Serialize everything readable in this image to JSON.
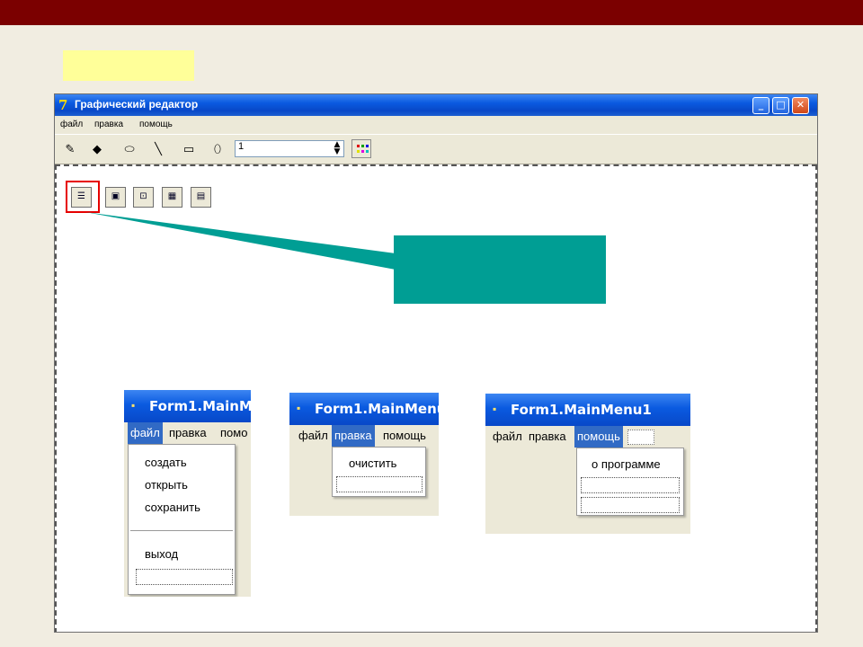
{
  "app": {
    "title": "Графический редактор",
    "menu": [
      "файл",
      "правка",
      "помощь"
    ],
    "width_value": "1",
    "window_buttons": {
      "minimize": "_",
      "maximize": "□",
      "close": "✕"
    }
  },
  "toolbar_icons": [
    "pencil-icon",
    "fill-icon",
    "eraser-icon",
    "line-icon",
    "rectangle-icon",
    "ellipse-icon"
  ],
  "nonvisual_components": [
    "mainmenu-icon",
    "savedialog-icon",
    "xpmanifest-icon",
    "colordialog-icon",
    "opendialog-icon"
  ],
  "forms": [
    {
      "title": "Form1.MainM",
      "menu": [
        "файл",
        "правка",
        "помо"
      ],
      "selected": "файл",
      "items": [
        "создать",
        "открыть",
        "сохранить",
        "выход"
      ]
    },
    {
      "title": "Form1.MainMenu",
      "menu": [
        "файл",
        "правка",
        "помощь"
      ],
      "selected": "правка",
      "items": [
        "очистить"
      ]
    },
    {
      "title": "Form1.MainMenu1",
      "menu": [
        "файл",
        "правка",
        "помощь"
      ],
      "selected": "помощь",
      "items": [
        "о программе"
      ]
    }
  ],
  "colors": {
    "topbar": "#7b0000",
    "callout": "#009e94",
    "highlight": "#e60000",
    "label": "#ffff99"
  }
}
